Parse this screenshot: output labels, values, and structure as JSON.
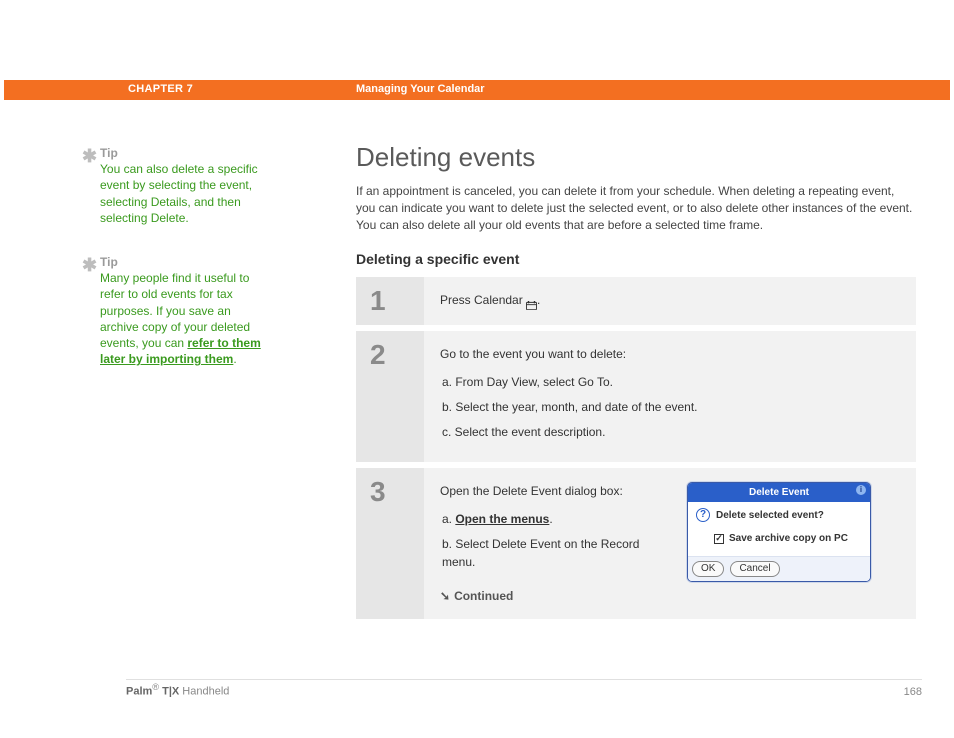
{
  "header": {
    "chapter": "CHAPTER 7",
    "section_title": "Managing Your Calendar"
  },
  "sidebar": {
    "tips": [
      {
        "label": "Tip",
        "body_pre": "You can also delete a specific event by selecting the event, selecting Details, and then selecting Delete.",
        "link": "",
        "body_post": ""
      },
      {
        "label": "Tip",
        "body_pre": "Many people find it useful to refer to old events for tax purposes. If you save an archive copy of your deleted events, you can ",
        "link": "refer to them later by importing them",
        "body_post": "."
      }
    ]
  },
  "main": {
    "h1": "Deleting events",
    "intro": "If an appointment is canceled, you can delete it from your schedule. When deleting a repeating event, you can indicate you want to delete just the selected event, or to also delete other instances of the event. You can also delete all your old events that are before a selected time frame.",
    "h2": "Deleting a specific event",
    "steps": {
      "s1": {
        "num": "1",
        "text_pre": "Press Calendar ",
        "text_post": "."
      },
      "s2": {
        "num": "2",
        "lead": "Go to the event you want to delete:",
        "a": "a.  From Day View, select Go To.",
        "b": "b.  Select the year, month, and date of the event.",
        "c": "c.  Select the event description."
      },
      "s3": {
        "num": "3",
        "lead": "Open the Delete Event dialog box:",
        "a_pre": "a.  ",
        "a_link": "Open the menus",
        "a_post": ".",
        "b": "b.  Select Delete Event on the Record menu.",
        "continued": "Continued"
      }
    },
    "dialog": {
      "title": "Delete Event",
      "question": "Delete selected event?",
      "checkbox_label": "Save archive copy on PC",
      "ok": "OK",
      "cancel": "Cancel"
    }
  },
  "footer": {
    "brand_bold": "Palm",
    "brand_reg": "®",
    "brand_model": " T|X",
    "brand_tail": " Handheld",
    "page": "168"
  }
}
